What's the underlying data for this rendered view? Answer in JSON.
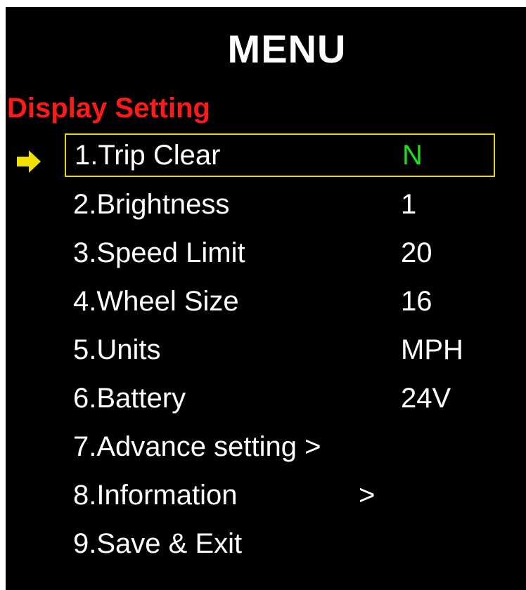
{
  "header": {
    "title": "MENU"
  },
  "section": {
    "title": "Display Setting"
  },
  "colors": {
    "section": "#ff1a1a",
    "selection_border": "#e8d800",
    "pointer": "#f0e000",
    "value_highlight": "#1ee01e",
    "background": "#000000",
    "text": "#ffffff"
  },
  "pointer": {
    "icon": "arrow-right-icon"
  },
  "menu": {
    "items": [
      {
        "label": "1.Trip Clear",
        "value": "N",
        "selected": true
      },
      {
        "label": "2.Brightness",
        "value": "1"
      },
      {
        "label": "3.Speed Limit",
        "value": "20"
      },
      {
        "label": "4.Wheel Size",
        "value": "16"
      },
      {
        "label": "5.Units",
        "value": "MPH"
      },
      {
        "label": "6.Battery",
        "value": "24V"
      },
      {
        "label": "7.Advance setting >",
        "value": ""
      },
      {
        "label": "8.Information",
        "chevron": ">",
        "value": ""
      },
      {
        "label": "9.Save & Exit",
        "value": ""
      }
    ]
  }
}
